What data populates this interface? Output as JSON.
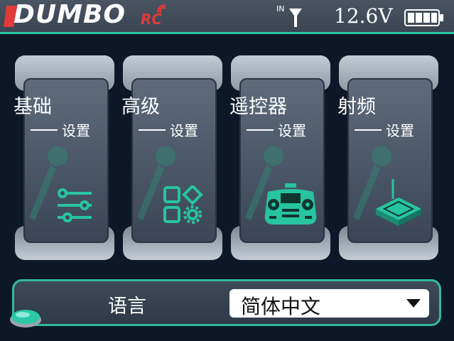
{
  "header": {
    "logo_text": "DUMBO",
    "logo_sub": "RC",
    "signal_tag": "IN",
    "voltage": "12.6V",
    "battery_level": 1.0,
    "accent_color": "#2bc7a6"
  },
  "cards": [
    {
      "title": "基础",
      "subtitle": "设置",
      "icon": "sliders-icon"
    },
    {
      "title": "高级",
      "subtitle": "设置",
      "icon": "apps-grid-icon"
    },
    {
      "title": "遥控器",
      "subtitle": "设置",
      "icon": "remote-controller-icon"
    },
    {
      "title": "射频",
      "subtitle": "设置",
      "icon": "rf-module-icon"
    }
  ],
  "language": {
    "label": "语言",
    "selected": "简体中文"
  },
  "colors": {
    "icon_accent": "#27c4a2",
    "background": "#0c1827"
  }
}
